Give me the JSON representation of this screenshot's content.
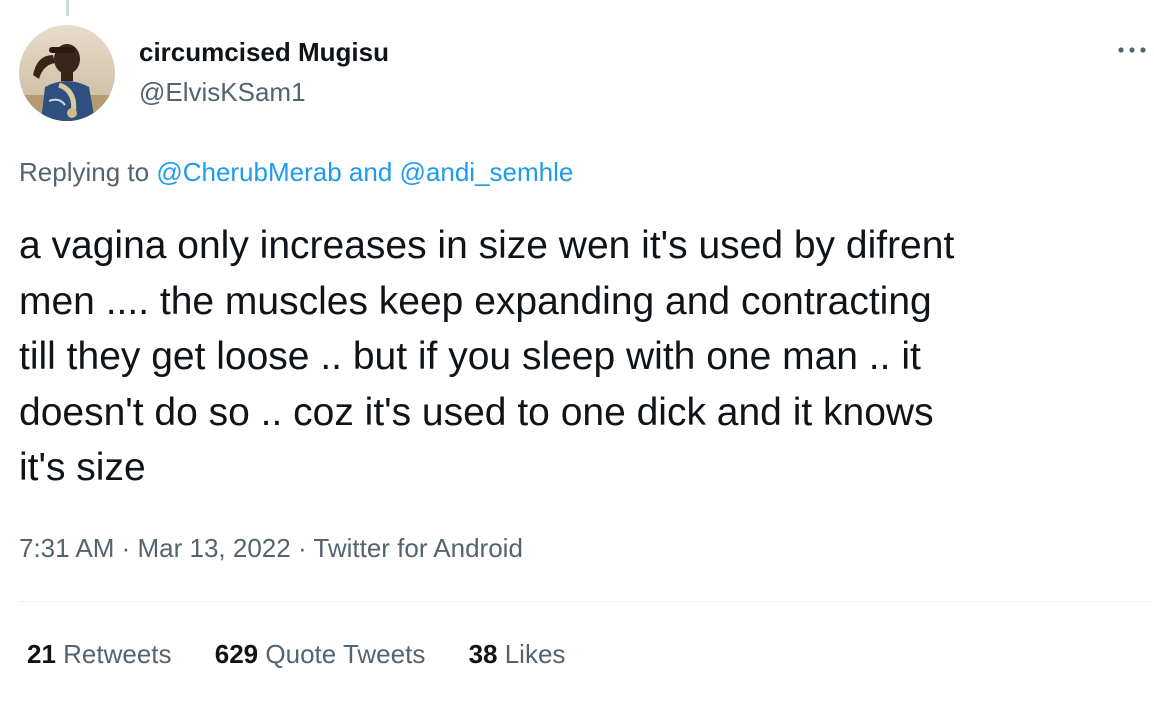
{
  "author": {
    "display_name": "circumcised Mugisu",
    "handle": "@ElvisKSam1"
  },
  "icons": {
    "more": "more-horizontal-icon",
    "avatar": "profile-photo"
  },
  "reply": {
    "prefix": "Replying to ",
    "mention1": "@CherubMerab",
    "connector": " and ",
    "mention2": "@andi_semhle"
  },
  "tweet": {
    "lines": [
      "a vagina only increases in size wen it's used by difrent",
      "men .... the muscles keep expanding and contracting",
      "till they get loose .. but if you sleep with one man .. it",
      "doesn't do so .. coz it's used to one dick and it knows",
      "it's size"
    ]
  },
  "meta": {
    "time": "7:31 AM",
    "separator": " · ",
    "date": "Mar 13, 2022",
    "source": "Twitter for Android"
  },
  "stats": {
    "retweets_count": "21",
    "retweets_label": " Retweets",
    "quotes_count": "629",
    "quotes_label": " Quote Tweets",
    "likes_count": "38",
    "likes_label": " Likes"
  },
  "colors": {
    "text_primary": "#0f1419",
    "text_secondary": "#536471",
    "link": "#1d9bf0",
    "divider": "#eff3f4"
  }
}
